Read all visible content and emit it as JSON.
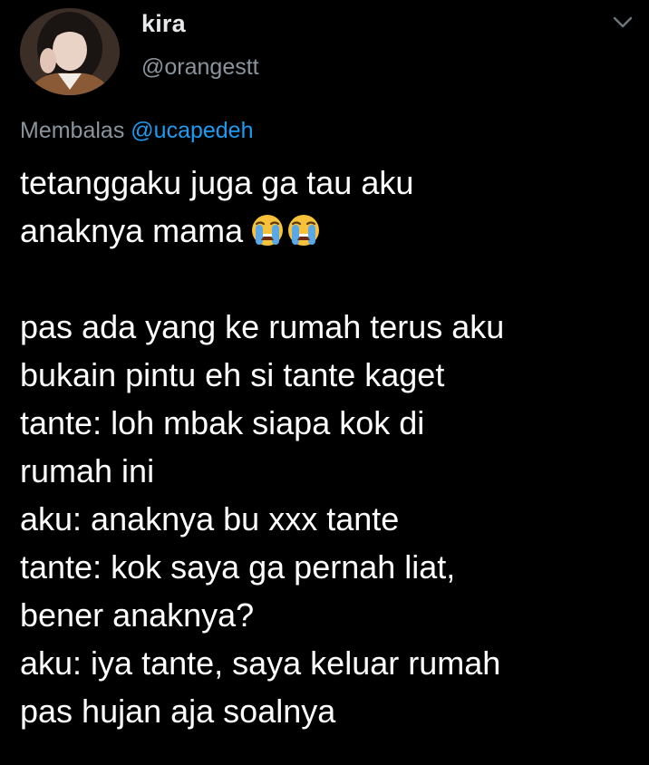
{
  "author": {
    "display_name": "kira",
    "handle": "@orangestt"
  },
  "reply": {
    "prefix": "Membalas",
    "mention": "@ucapedeh"
  },
  "tweet": {
    "lines": [
      "tetanggaku juga ga tau aku",
      "anaknya mama",
      "",
      "pas ada yang ke rumah terus aku",
      "bukain pintu eh si tante kaget",
      "tante: loh mbak siapa kok di",
      "rumah ini",
      "aku: anaknya bu xxx tante",
      "tante: kok saya ga pernah liat,",
      "bener anaknya?",
      "aku: iya tante, saya keluar rumah",
      "pas hujan aja soalnya"
    ],
    "emojis": [
      "loudly-crying-face-icon",
      "loudly-crying-face-icon"
    ]
  },
  "colors": {
    "background": "#000000",
    "secondary_text": "#8a949c",
    "link": "#1d9bf0",
    "text": "#ffffff"
  }
}
